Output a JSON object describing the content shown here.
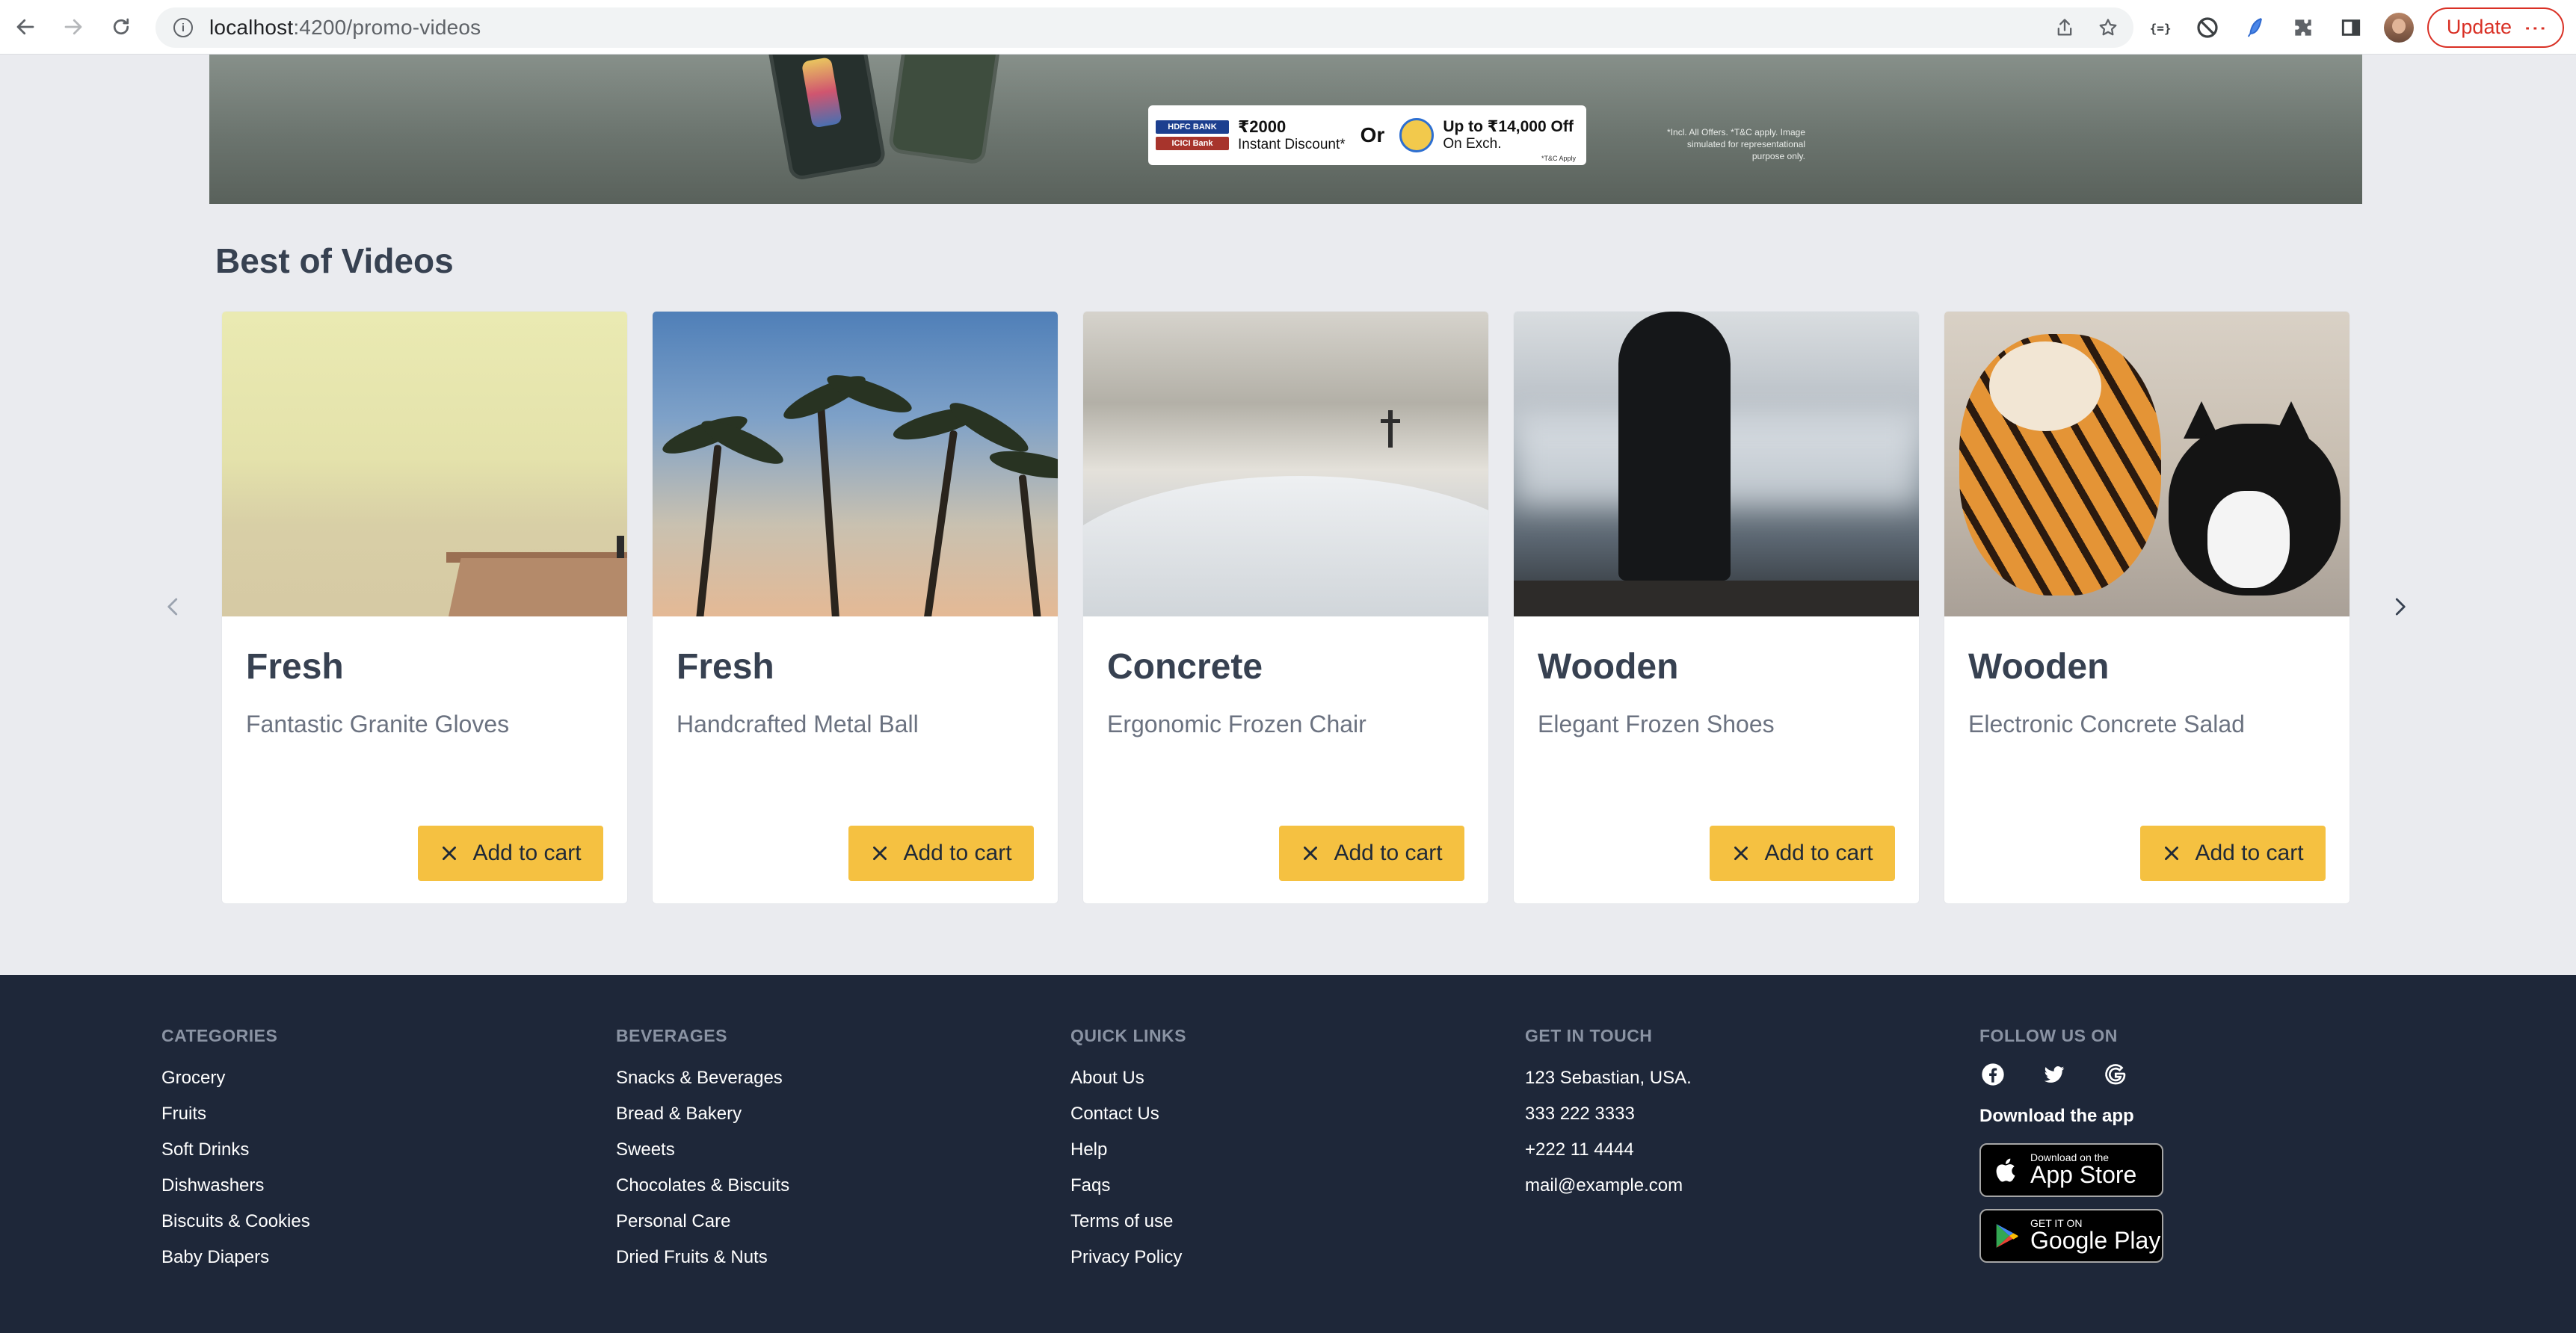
{
  "browser": {
    "url_host": "localhost",
    "url_path": ":4200/promo-videos",
    "update_label": "Update"
  },
  "banner": {
    "bank1": "HDFC BANK",
    "bank2": "ICICI Bank",
    "discount_amount": "₹2000",
    "discount_text": "Instant Discount*",
    "or": "Or",
    "exchange_amount": "Up to ₹14,000 Off",
    "exchange_text": "On Exch.",
    "tnc": "*T&C Apply",
    "fine_print": "*Incl. All Offers. *T&C apply. Image simulated for representational purpose only."
  },
  "section": {
    "title": "Best of Videos"
  },
  "products": [
    {
      "category": "Fresh",
      "name": "Fantastic Granite Gloves",
      "button": "Add to cart"
    },
    {
      "category": "Fresh",
      "name": "Handcrafted Metal Ball",
      "button": "Add to cart"
    },
    {
      "category": "Concrete",
      "name": "Ergonomic Frozen Chair",
      "button": "Add to cart"
    },
    {
      "category": "Wooden",
      "name": "Elegant Frozen Shoes",
      "button": "Add to cart"
    },
    {
      "category": "Wooden",
      "name": "Electronic Concrete Salad",
      "button": "Add to cart"
    }
  ],
  "footer": {
    "categories": {
      "title": "CATEGORIES",
      "items": [
        "Grocery",
        "Fruits",
        "Soft Drinks",
        "Dishwashers",
        "Biscuits & Cookies",
        "Baby Diapers"
      ]
    },
    "beverages": {
      "title": "BEVERAGES",
      "items": [
        "Snacks & Beverages",
        "Bread & Bakery",
        "Sweets",
        "Chocolates & Biscuits",
        "Personal Care",
        "Dried Fruits & Nuts"
      ]
    },
    "quick_links": {
      "title": "QUICK LINKS",
      "items": [
        "About Us",
        "Contact Us",
        "Help",
        "Faqs",
        "Terms of use",
        "Privacy Policy"
      ]
    },
    "contact": {
      "title": "GET IN TOUCH",
      "items": [
        "123 Sebastian, USA.",
        "333 222 3333",
        "+222 11 4444",
        "mail@example.com"
      ]
    },
    "follow": {
      "title": "FOLLOW US ON",
      "download": "Download the app",
      "app_store_small": "Download on the",
      "app_store_big": "App Store",
      "play_small": "GET IT ON",
      "play_big": "Google Play"
    }
  }
}
